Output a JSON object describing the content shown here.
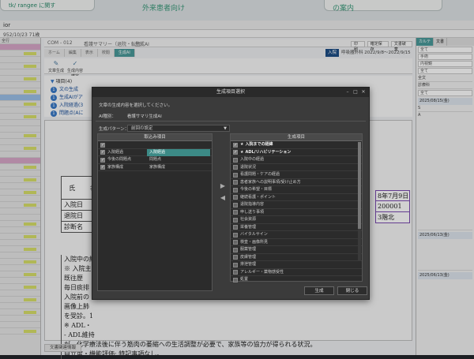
{
  "banner": {
    "left_text": "tk/ rangee に関す",
    "mid_text": "外来患者向け",
    "right_text": "の案内"
  },
  "window": {
    "title": "ior",
    "subtitle": "952/10/23  71歳"
  },
  "document": {
    "header_left": "COM - 012",
    "header_mid": "看護サマリー（退院・転院）",
    "header_sub": "生成AI",
    "toolbar": [
      "印刷",
      "確定保存",
      "文書破棄"
    ],
    "tabs": [
      "ホーム",
      "編集",
      "表示",
      "校閲",
      "生成AI"
    ],
    "active_tab": "生成AI",
    "period_pill": "入院",
    "period_text": "呼吸器外科 2022/9/8〜2022/9/15",
    "icon_buttons": [
      {
        "label": "文章生成",
        "glyph": "✎"
      },
      {
        "label": "生成内容確定",
        "glyph": "✓"
      }
    ],
    "items_header": "項目(4)",
    "items": [
      {
        "num": "1",
        "text": "文の生成"
      },
      {
        "num": "1",
        "text": "生成AIがア"
      },
      {
        "num": "1",
        "text": "入院経過(3"
      },
      {
        "num": "1",
        "text": "問題点(Aに"
      }
    ],
    "form_labels": [
      "氏 名",
      "入院日",
      "退院日",
      "診断名"
    ],
    "right_values": [
      "8年7月9日",
      "200001",
      "3階北"
    ],
    "body_lines": [
      "入院中の経",
      "※ 入院主",
      "既往歴",
      "毎日痰排",
      "入院前の",
      "画像上肺",
      "を受診。1",
      "※ ADL・",
      "- ADL維持",
      "が、化学療法後に伴う筋肉の萎縮への生活調整が必要で、家族等の協力が得られる状況。",
      "自立度・機能評価: 特記事項なし。"
    ],
    "footer_tab": "文書関連情報"
  },
  "right_panel": {
    "tabs": [
      "カルテ",
      "文書"
    ],
    "active_tab": "カルテ",
    "fields": [
      "全て",
      "手術",
      "内視鏡",
      "全て",
      "全て"
    ],
    "rows": [
      "2025/08/15(金)",
      "S",
      "A",
      "2025/06/13(金)",
      "2025/06/13(金)"
    ],
    "labels": [
      "全文",
      "診療科"
    ]
  },
  "left_panel": {
    "label": "全行"
  },
  "dialog": {
    "title": "生成項目選択",
    "message": "文章の生成内容を選択してください。",
    "ai_label": "AI種別：",
    "ai_value": "看護サマリ生成AI",
    "pattern_label": "生成パターン：",
    "pattern_value": "前回の設定",
    "left_header": "取込み項目",
    "right_header": "生成項目",
    "left_items": [
      {
        "label": "入院経過",
        "value": "入院経過",
        "selected": true
      },
      {
        "label": "今後の問題点",
        "value": "問題点",
        "selected": false
      },
      {
        "label": "家族構成",
        "value": "家族構成",
        "selected": false
      }
    ],
    "right_items": [
      {
        "label": "入院までの経緯",
        "star": true,
        "bold": true
      },
      {
        "label": "ADL/リハビリテーション",
        "star": true,
        "bold": true
      },
      {
        "label": "入院中の経過",
        "star": false
      },
      {
        "label": "退院状況",
        "star": false
      },
      {
        "label": "看護問題・ケアの経過",
        "star": false
      },
      {
        "label": "患者家族への説明事項/受け止め方",
        "star": false
      },
      {
        "label": "今後の希望・目標",
        "star": false
      },
      {
        "label": "継続看護・ポイント",
        "star": false
      },
      {
        "label": "退院指導内容",
        "star": false
      },
      {
        "label": "申し送り事項",
        "star": false
      },
      {
        "label": "社会資源",
        "star": false
      },
      {
        "label": "栄養管理",
        "star": false
      },
      {
        "label": "バイタルサイン",
        "star": false
      },
      {
        "label": "検査・画像所見",
        "star": false
      },
      {
        "label": "服薬管理",
        "star": false
      },
      {
        "label": "皮膚管理",
        "star": false
      },
      {
        "label": "排泄管理",
        "star": false
      },
      {
        "label": "アレルギー・薬物感受性",
        "star": false
      },
      {
        "label": "処置",
        "star": false
      }
    ],
    "generate_button": "生成",
    "close_button": "閉じる"
  },
  "colors": {
    "accent": "#4a9a9a",
    "selected_row": "#3c8a86",
    "dialog_bg": "#3b3b3b"
  }
}
